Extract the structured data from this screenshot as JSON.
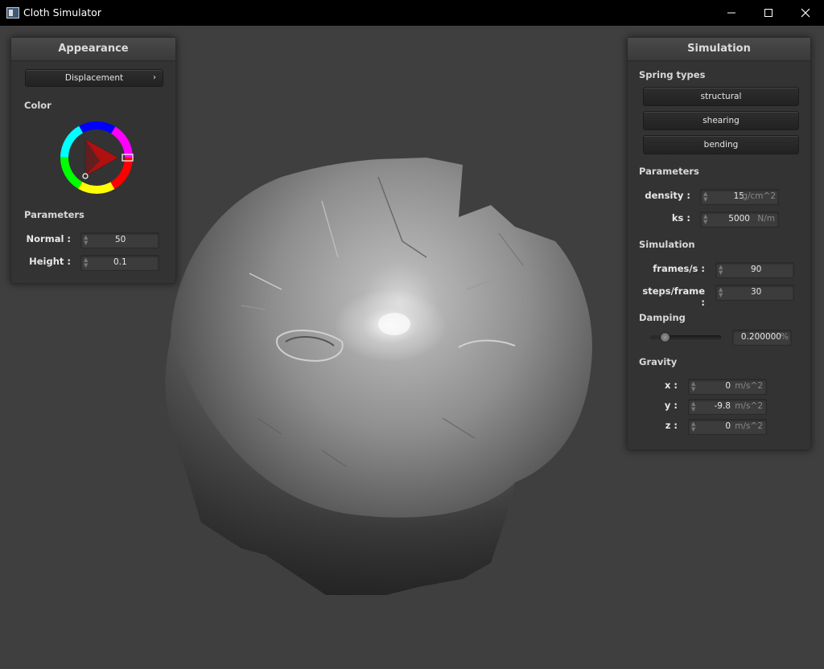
{
  "window": {
    "title": "Cloth Simulator",
    "controls": [
      "minimize-icon",
      "maximize-icon",
      "close-icon"
    ]
  },
  "appearance": {
    "title": "Appearance",
    "shader_dropdown": "Displacement",
    "color_label": "Color",
    "parameters_label": "Parameters",
    "normal_label": "Normal :",
    "normal_value": "50",
    "height_label": "Height :",
    "height_value": "0.1",
    "selected_color": "#ff0000"
  },
  "simulation": {
    "title": "Simulation",
    "spring_types_label": "Spring types",
    "spring_buttons": [
      "structural",
      "shearing",
      "bending"
    ],
    "parameters_label": "Parameters",
    "density_label": "density :",
    "density_value": "15",
    "density_unit": "g/cm^2",
    "ks_label": "ks :",
    "ks_value": "5000",
    "ks_unit": "N/m",
    "simulation_label": "Simulation",
    "fps_label": "frames/s :",
    "fps_value": "90",
    "steps_label": "steps/frame :",
    "steps_value": "30",
    "damping_label": "Damping",
    "damping_value": "0.200000",
    "damping_unit": "%",
    "damping_slider_fraction": 0.2,
    "gravity_label": "Gravity",
    "gx_label": "x :",
    "gx_value": "0",
    "gy_label": "y :",
    "gy_value": "-9.8",
    "gz_label": "z :",
    "gz_value": "0",
    "gravity_unit": "m/s^2"
  }
}
